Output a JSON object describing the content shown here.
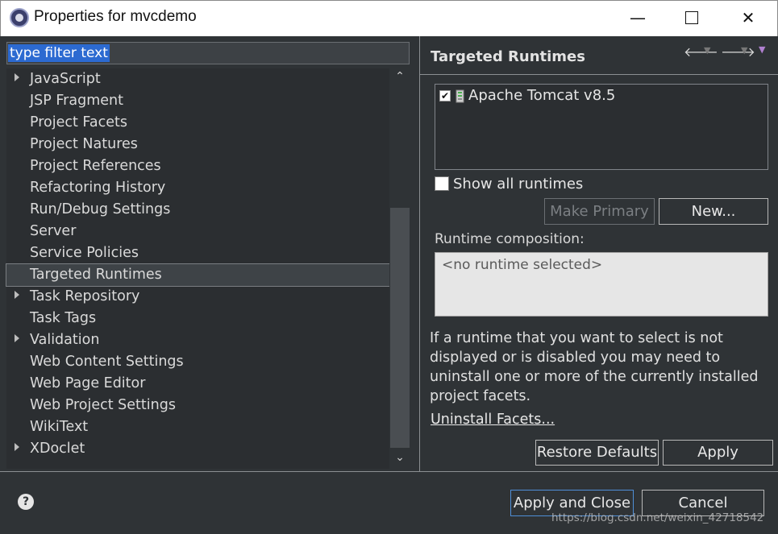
{
  "window": {
    "title": "Properties for mvcdemo",
    "controls": {
      "minimize": "—",
      "close": "✕"
    }
  },
  "filter": {
    "value": "type filter text"
  },
  "tree": {
    "items": [
      {
        "label": "JavaScript",
        "expandable": true
      },
      {
        "label": "JSP Fragment",
        "expandable": false
      },
      {
        "label": "Project Facets",
        "expandable": false
      },
      {
        "label": "Project Natures",
        "expandable": false
      },
      {
        "label": "Project References",
        "expandable": false
      },
      {
        "label": "Refactoring History",
        "expandable": false
      },
      {
        "label": "Run/Debug Settings",
        "expandable": false
      },
      {
        "label": "Server",
        "expandable": false
      },
      {
        "label": "Service Policies",
        "expandable": false
      },
      {
        "label": "Targeted Runtimes",
        "expandable": false,
        "selected": true
      },
      {
        "label": "Task Repository",
        "expandable": true
      },
      {
        "label": "Task Tags",
        "expandable": false
      },
      {
        "label": "Validation",
        "expandable": true
      },
      {
        "label": "Web Content Settings",
        "expandable": false
      },
      {
        "label": "Web Page Editor",
        "expandable": false
      },
      {
        "label": "Web Project Settings",
        "expandable": false
      },
      {
        "label": "WikiText",
        "expandable": false
      },
      {
        "label": "XDoclet",
        "expandable": true
      }
    ]
  },
  "page": {
    "title": "Targeted Runtimes",
    "runtimes": [
      {
        "label": "Apache Tomcat v8.5",
        "checked": true
      }
    ],
    "show_all_label": "Show all runtimes",
    "make_primary_label": "Make Primary",
    "new_label": "New...",
    "composition_label": "Runtime composition:",
    "composition_value": "<no runtime selected>",
    "info": "If a runtime that you want to select is not displayed or is disabled you may need to uninstall one or more of the currently installed project facets.",
    "uninstall_link": "Uninstall Facets...",
    "restore_defaults_label": "Restore Defaults",
    "apply_label": "Apply"
  },
  "footer": {
    "help": "?",
    "apply_close_label": "Apply and Close",
    "cancel_label": "Cancel"
  },
  "watermark": "https://blog.csdn.net/weixin_42718542"
}
